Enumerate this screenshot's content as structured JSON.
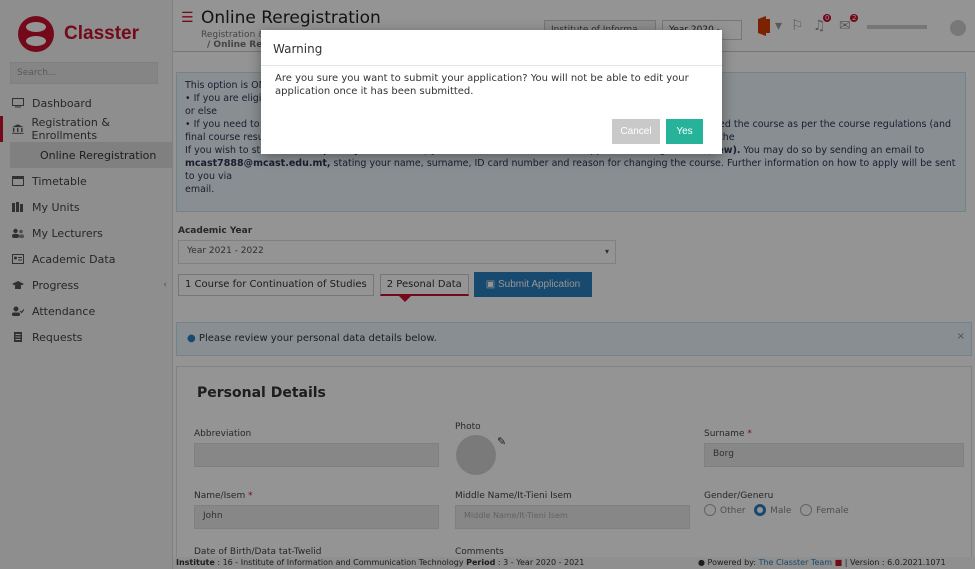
{
  "app": {
    "logo_text": "Classter",
    "search_placeholder": "Search..."
  },
  "sidebar": {
    "items": [
      {
        "label": "Dashboard",
        "icon": "monitor-icon"
      },
      {
        "label": "Registration & Enrollments",
        "icon": "institution-icon"
      },
      {
        "label": "Timetable",
        "icon": "calendar-icon"
      },
      {
        "label": "My Units",
        "icon": "books-icon"
      },
      {
        "label": "My Lecturers",
        "icon": "people-icon"
      },
      {
        "label": "Academic Data",
        "icon": "id-card-icon"
      },
      {
        "label": "Progress",
        "icon": "graduation-cap-icon"
      },
      {
        "label": "Attendance",
        "icon": "user-check-icon"
      },
      {
        "label": "Requests",
        "icon": "document-icon"
      }
    ],
    "sub_item": "Online Reregistration",
    "progress_caret": "‹"
  },
  "header": {
    "title": "Online Reregistration",
    "breadcrumb_1": "Registration &",
    "breadcrumb_2": "/ Online Rer",
    "institute": "Institute of Informa",
    "year_select": "Year 2020 - 2021 ▾",
    "notif_bell_count": "0",
    "notif_mail_count": "2"
  },
  "info": {
    "line1": "This option is ON",
    "line2": "• If you are eligib",
    "line3": "or else",
    "line4": "• If you need to r",
    "line4_tail": "ed the course as per the course regulations (and the",
    "line5": "final course results as presented to you by your Institute).",
    "line6_a": "If you wish to start off a ",
    "line6_b": "completely new course,",
    "line6_c": " you will then need to submit an application using Form ",
    "line6_d": "A (new).",
    "line6_e": " You may do so by sending an email to",
    "line7_a": "mcast7888@mcast.edu.mt,",
    "line7_b": " stating your name, surname, ID card number and reason for changing the course. Further information on how to apply will be sent to you via",
    "line8": "email."
  },
  "academic_year": {
    "label": "Academic Year",
    "value": "Year 2021 - 2022"
  },
  "steps": {
    "step1": "1  Course for Continuation of Studies",
    "step2": "2  Pesonal Data",
    "submit": "Submit Application"
  },
  "alert": {
    "text": "Please review your personal data details below."
  },
  "personal": {
    "title": "Personal Details",
    "abbreviation_label": "Abbreviation",
    "photo_label": "Photo",
    "surname_label": "Surname",
    "surname_value": "Borg",
    "name_label": "Name/Isem",
    "name_value": "John",
    "middle_label": "Middle Name/It-Tieni Isem",
    "middle_placeholder": "Middle Name/It-Tieni Isem",
    "gender_label": "Gender/Generu",
    "gender_options": [
      "Other",
      "Male",
      "Female"
    ],
    "gender_selected": "Male",
    "dob_label": "Date of Birth/Data tat-Twelid",
    "comments_label": "Comments"
  },
  "footer": {
    "left_a": "Institute",
    "left_b": " : 16 - Institute of Information and Communication Technology ",
    "left_c": "Period",
    "left_d": " : 3 - Year 2020 - 2021",
    "powered": "Powered by:",
    "team": "The Classter Team",
    "version": "| Version : 6.0.2021.1071"
  },
  "modal": {
    "title": "Warning",
    "body": "Are you sure you want to submit your application? You will not be able to edit your application once it has been submitted.",
    "cancel": "Cancel",
    "yes": "Yes"
  },
  "colors": {
    "brand": "#c8102e",
    "primary": "#2a7fbf",
    "success": "#26b39a"
  }
}
